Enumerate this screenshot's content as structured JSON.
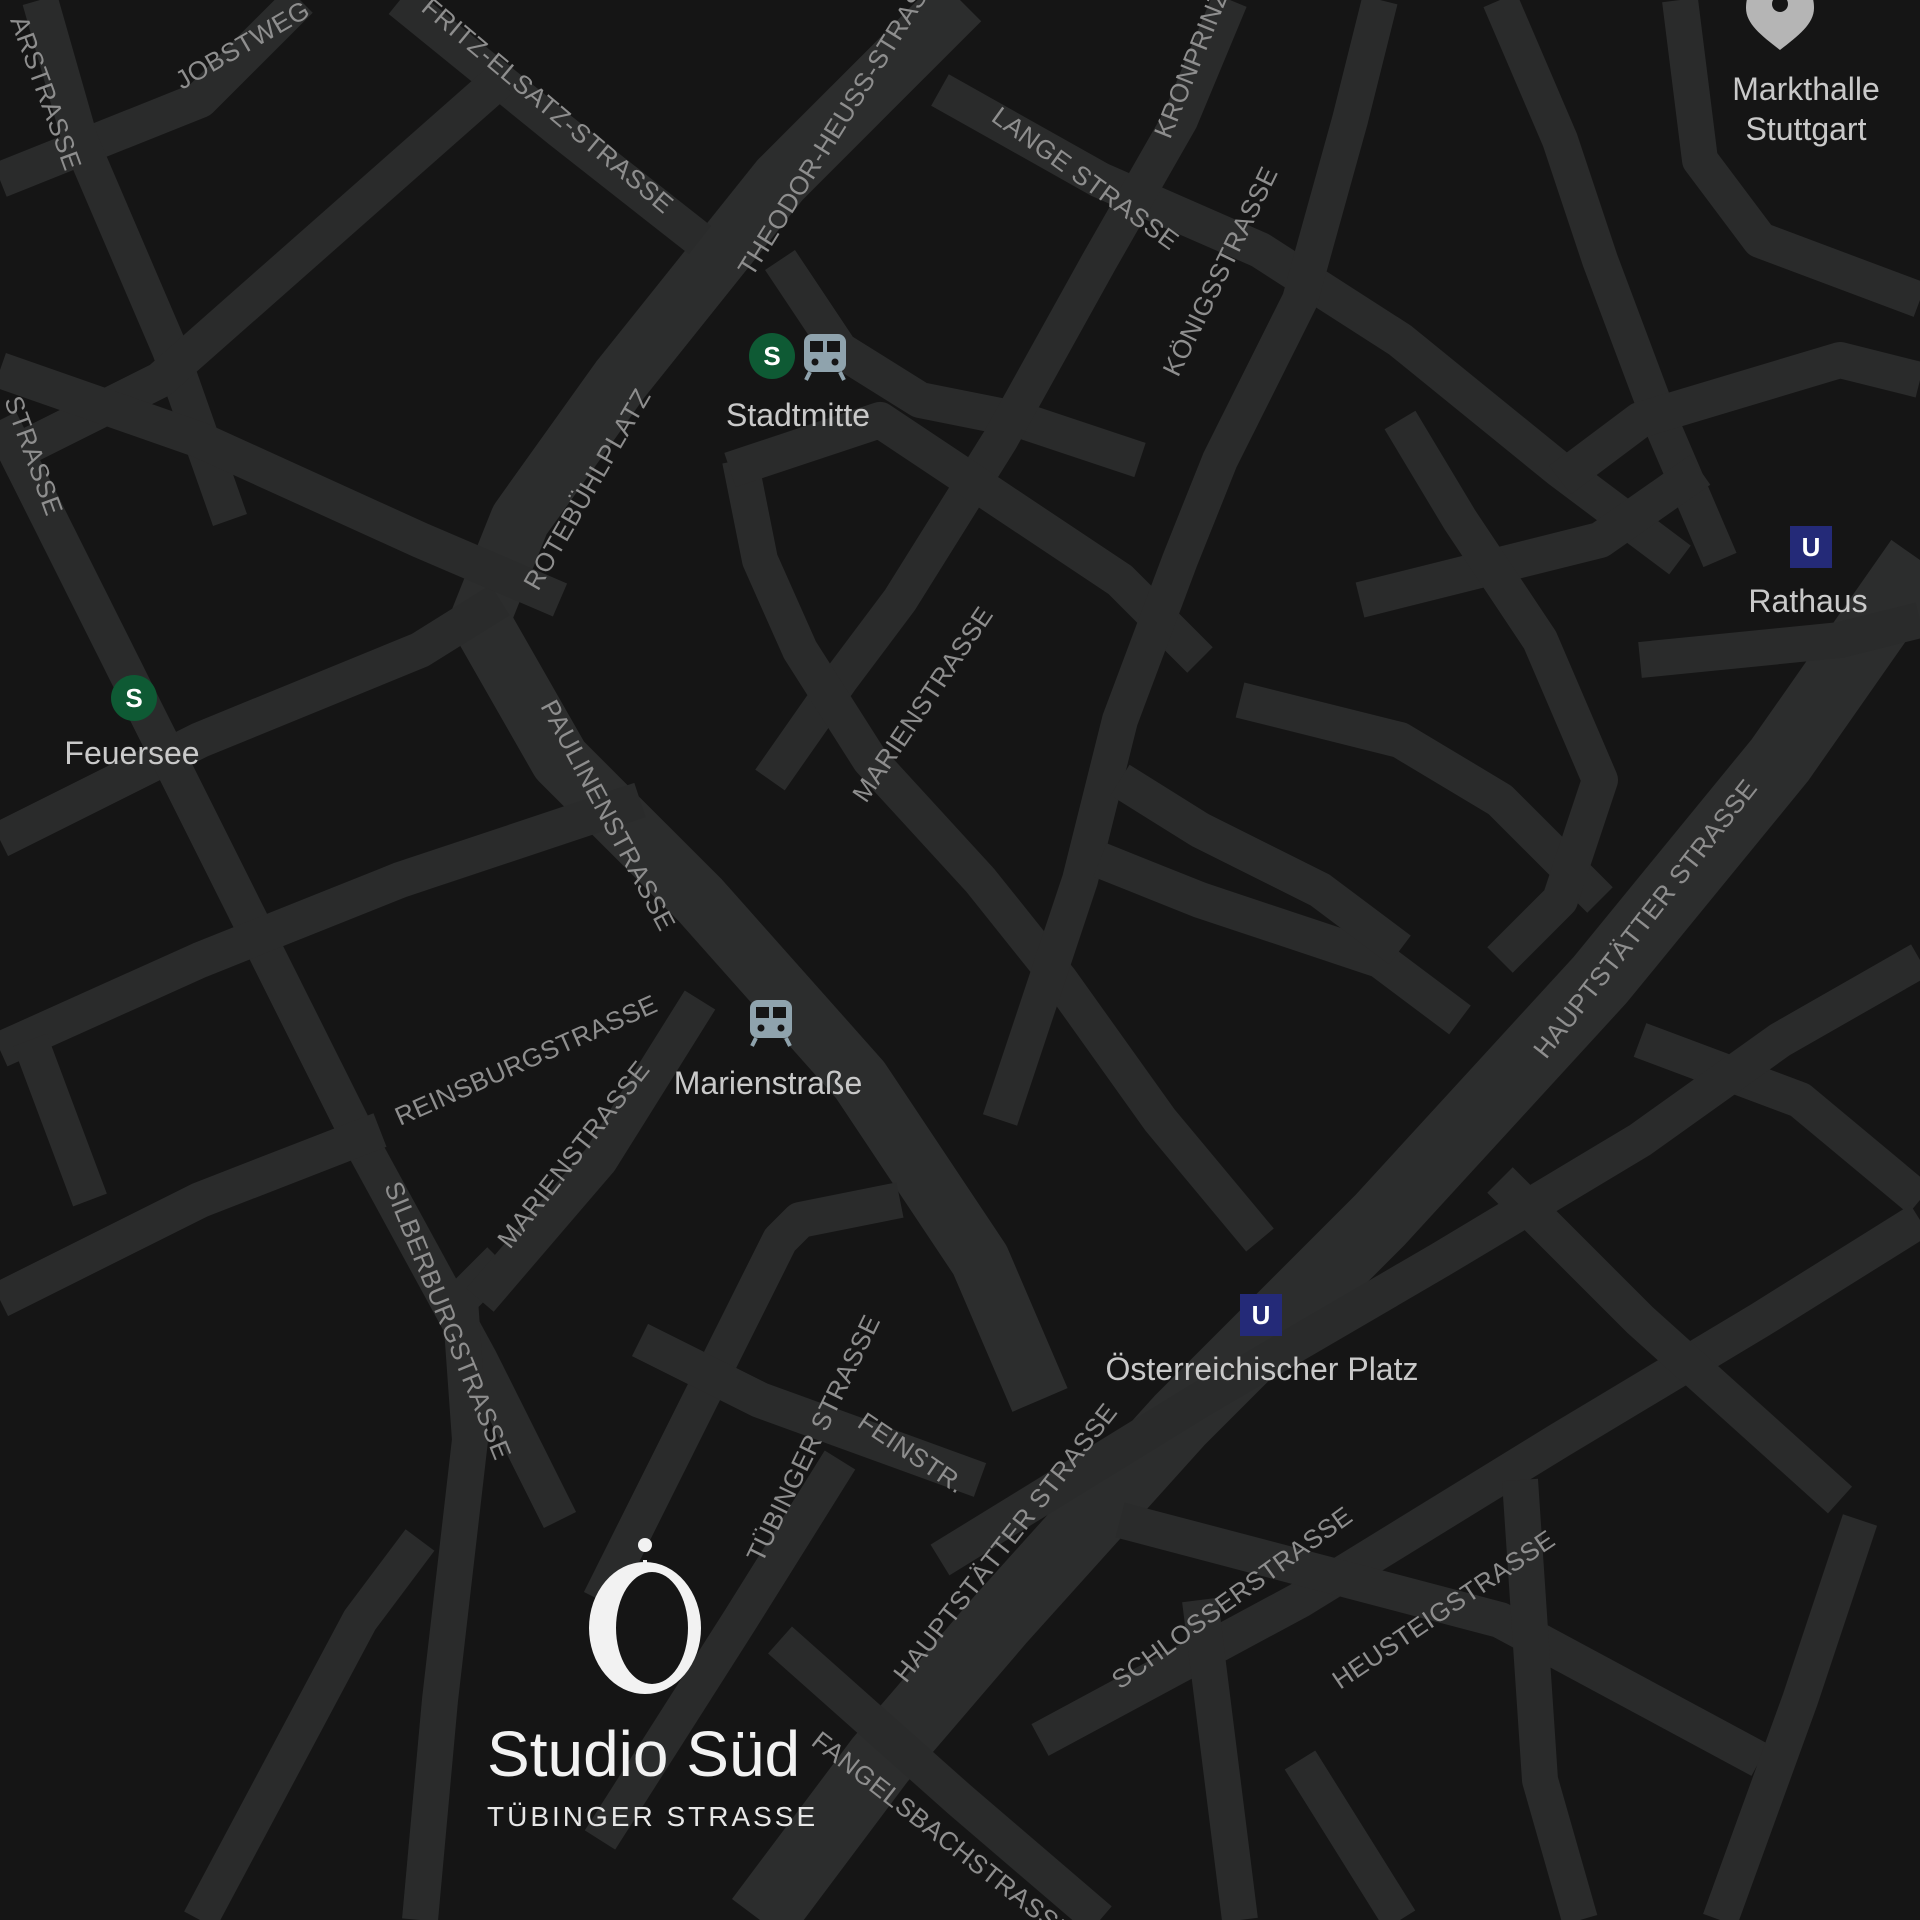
{
  "map": {
    "colors": {
      "background": "#151515",
      "road": "#2a2b2b",
      "street_label": "#8e8e8e",
      "place_label": "#c9c9c9",
      "s_bahn_badge": "#0e5a34",
      "u_bahn_badge": "#242a78",
      "train_icon": "#8fa3ad",
      "pin_icon": "#b5b5b5",
      "brand_text": "#f2f2f2"
    },
    "streets": {
      "jobstweg": "JOBSTWEG",
      "arstrasse": "ARSTRASSE",
      "fritz_elsatz": "FRITZ-ELSATZ-STRASSE",
      "theodor_heuss": "THEODOR-HEUSS-STRASSE",
      "lange": "LANGE STRASSE",
      "kronprinz": "KRONPRINZS",
      "koenigs": "KÖNIGSSTRASSE",
      "strasse_left": "STRASSE",
      "rotebuehlplatz": "ROTEBÜHLPLATZ",
      "paulinen": "PAULINENSTRASSE",
      "marien_upper": "MARIENSTRASSE",
      "marien_lower": "MARIENSTRASSE",
      "reinsburg": "REINSBURGSTRASSE",
      "silberburg": "SILBERBURGSTRASSE",
      "tuebinger": "TÜBINGER STRASSE",
      "feinstr": "FEINSTR.",
      "hauptstaetter_lower": "HAUPTSTÄTTER STRASSE",
      "hauptstaetter_upper": "HAUPTSTÄTTER STRASSE",
      "schloss": "SCHLOSSERSTRASSE",
      "heusteig": "HEUSTEIGSTRASSE",
      "fangelsbach": "FANGELSBACHSTRASSE"
    },
    "places": {
      "stadtmitte": {
        "label": "Stadtmitte",
        "badge": "S",
        "icon": "train-icon"
      },
      "feuersee": {
        "label": "Feuersee",
        "badge": "S"
      },
      "marienstrasse": {
        "label": "Marienstraße",
        "icon": "train-icon"
      },
      "rathaus": {
        "label": "Rathaus",
        "badge": "U"
      },
      "oesterreichischer_platz": {
        "label": "Österreichischer Platz",
        "badge": "U"
      },
      "markthalle": {
        "label_line1": "Markthalle",
        "label_line2": "Stuttgart",
        "icon": "map-pin-icon"
      }
    },
    "studio": {
      "name": "Studio Süd",
      "subtitle": "TÜBINGER STRASSE",
      "icon": "studio-logo-icon"
    }
  }
}
